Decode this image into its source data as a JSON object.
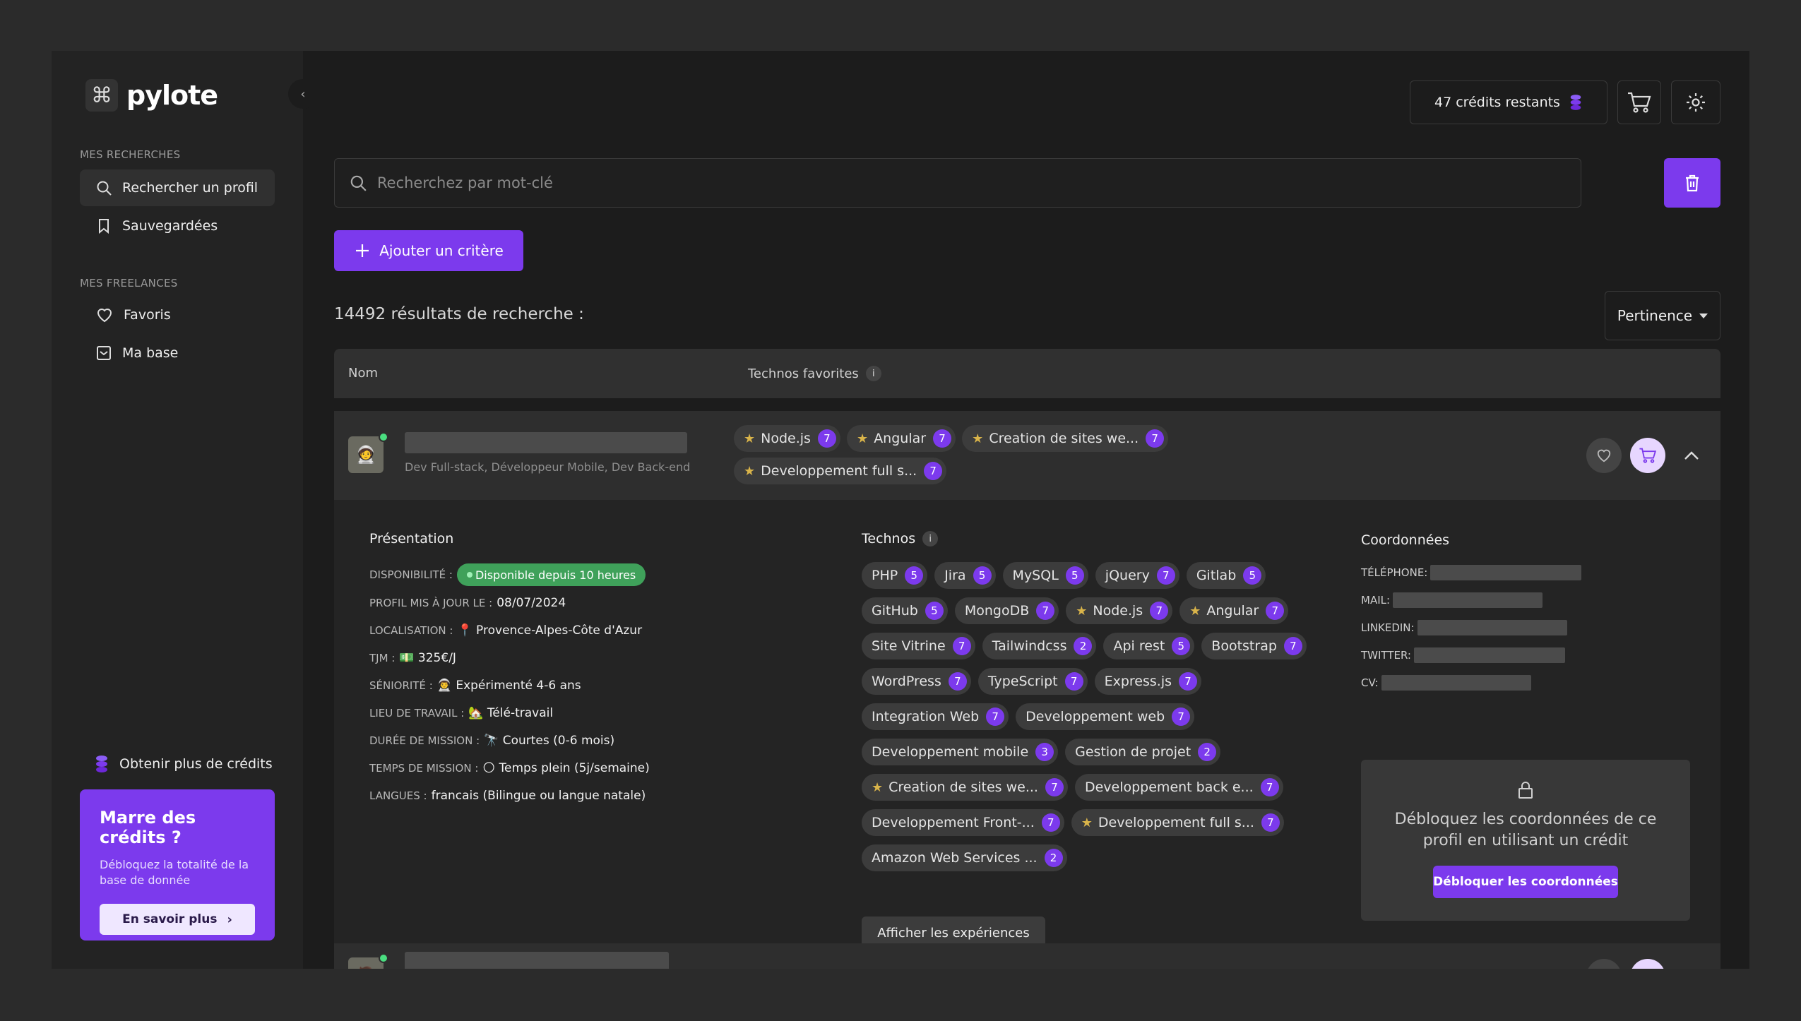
{
  "app": {
    "logo_text": "pylote"
  },
  "sidebar": {
    "section_searches": "MES RECHERCHES",
    "search_item": "Rechercher un profil",
    "saved_item": "Sauvegardées",
    "section_freelances": "MES FREELANCES",
    "favorites_item": "Favoris",
    "base_item": "Ma base",
    "credits_link": "Obtenir plus de crédits",
    "promo": {
      "title": "Marre des crédits ?",
      "text": "Débloquez la totalité de la base de donnée",
      "button": "En savoir plus"
    }
  },
  "topbar": {
    "credits": "47 crédits restants"
  },
  "search": {
    "placeholder": "Recherchez par mot-clé"
  },
  "add_criteria": "Ajouter un critère",
  "results_count": "14492 résultats de recherche :",
  "sort": {
    "selected": "Pertinence"
  },
  "table": {
    "col_name": "Nom",
    "col_techs": "Technos favorites",
    "info": "i"
  },
  "row1": {
    "subtitle": "Dev Full-stack, Développeur Mobile, Dev Back-end",
    "tags": [
      {
        "label": "Node.js",
        "count": "7"
      },
      {
        "label": "Angular",
        "count": "7"
      },
      {
        "label": "Creation de sites we...",
        "count": "7"
      },
      {
        "label": "Developpement full s...",
        "count": "7"
      }
    ]
  },
  "details": {
    "presentation_title": "Présentation",
    "availability_key": "DISPONIBILITÉ :",
    "availability_value": "Disponible depuis 10 heures",
    "updated_key": "PROFIL MIS À JOUR LE :",
    "updated_value": "08/07/2024",
    "location_key": "LOCALISATION :",
    "location_value": "📍 Provence-Alpes-Côte d'Azur",
    "tjm_key": "TJM :",
    "tjm_value": "💵 325€/J",
    "seniority_key": "SÉNIORITÉ :",
    "seniority_value": "👨‍🚀 Expérimenté 4-6 ans",
    "workplace_key": "LIEU DE TRAVAIL :",
    "workplace_value": "🏡 Télé-travail",
    "duration_key": "DURÉE DE MISSION :",
    "duration_value": "🔭 Courtes (0-6 mois)",
    "time_key": "TEMPS DE MISSION :",
    "time_value": "🌕 Temps plein (5j/semaine)",
    "languages_key": "LANGUES :",
    "languages_value": "francais (Bilingue ou langue natale)",
    "techs_title": "Technos",
    "techs": [
      {
        "label": "PHP",
        "count": "5",
        "star": false
      },
      {
        "label": "Jira",
        "count": "5",
        "star": false
      },
      {
        "label": "MySQL",
        "count": "5",
        "star": false
      },
      {
        "label": "jQuery",
        "count": "7",
        "star": false
      },
      {
        "label": "Gitlab",
        "count": "5",
        "star": false
      },
      {
        "label": "GitHub",
        "count": "5",
        "star": false
      },
      {
        "label": "MongoDB",
        "count": "7",
        "star": false
      },
      {
        "label": "Node.js",
        "count": "7",
        "star": true
      },
      {
        "label": "Angular",
        "count": "7",
        "star": true
      },
      {
        "label": "Site Vitrine",
        "count": "7",
        "star": false
      },
      {
        "label": "Tailwindcss",
        "count": "2",
        "star": false
      },
      {
        "label": "Api rest",
        "count": "5",
        "star": false
      },
      {
        "label": "Bootstrap",
        "count": "7",
        "star": false
      },
      {
        "label": "WordPress",
        "count": "7",
        "star": false
      },
      {
        "label": "TypeScript",
        "count": "7",
        "star": false
      },
      {
        "label": "Express.js",
        "count": "7",
        "star": false
      },
      {
        "label": "Integration Web",
        "count": "7",
        "star": false
      },
      {
        "label": "Developpement web",
        "count": "7",
        "star": false
      },
      {
        "label": "Developpement mobile",
        "count": "3",
        "star": false
      },
      {
        "label": "Gestion de projet",
        "count": "2",
        "star": false
      },
      {
        "label": "Creation de sites we...",
        "count": "7",
        "star": true
      },
      {
        "label": "Developpement back e...",
        "count": "7",
        "star": false
      },
      {
        "label": "Developpement Front-...",
        "count": "7",
        "star": false
      },
      {
        "label": "Developpement full s...",
        "count": "7",
        "star": true
      },
      {
        "label": "Amazon Web Services ...",
        "count": "2",
        "star": false
      }
    ],
    "experiences_button": "Afficher les expériences",
    "contacts_title": "Coordonnées",
    "phone_key": "TÉLÉPHONE:",
    "mail_key": "MAIL:",
    "linkedin_key": "LINKEDIN:",
    "twitter_key": "TWITTER:",
    "cv_key": "CV:",
    "unlock_text": "Débloquez les coordonnées de ce profil en utilisant un crédit",
    "unlock_button": "Débloquer les coordonnées"
  },
  "colors": {
    "accent": "#7c3aed",
    "available": "#3fa15a",
    "star": "#d9b44a"
  }
}
